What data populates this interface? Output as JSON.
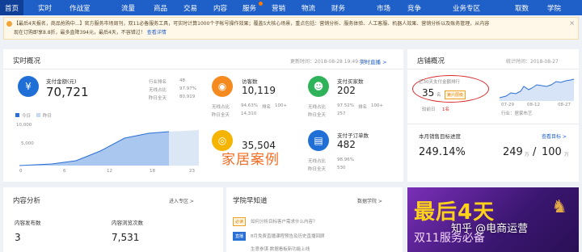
{
  "nav": {
    "items": [
      "首页",
      "实时",
      "作战室",
      "流量",
      "商品",
      "交易",
      "内容",
      "服务",
      "营销",
      "物流",
      "财务",
      "市场",
      "竞争",
      "业务专区",
      "取数",
      "学院"
    ],
    "active_index": 0
  },
  "notice": {
    "line1": "【最后4天报名，商品抢购中...】官方服务市场周刊，双11必备服务工具，可实时计算1000个子帐号操作效果；覆盖5大核心场景，重点包括：营销分析、服务体验、人工客服、机器人效果、营销分析以及账务管理，从内容",
    "line2": "现在订购即享8.8折，最多直降394元，最后4天，不容错过！",
    "link": "查看详情",
    "close": "×"
  },
  "realtime": {
    "title": "实时概况",
    "updated": "更新时间：2018-08-28 19:49:14",
    "view_link": "实时直播 >",
    "payment": {
      "label": "支付金额(元)",
      "value": "70,721",
      "stats": [
        {
          "name": "行业排名",
          "value": "48"
        },
        {
          "name": "无线占比",
          "value": "97.97%"
        },
        {
          "name": "昨日全天",
          "value": "80,919"
        }
      ]
    },
    "legend": {
      "today": "今日",
      "yesterday": "昨日"
    },
    "chart_y": [
      "10,000",
      "5,000"
    ],
    "chart_x": [
      "0",
      "6",
      "12",
      "18",
      "23"
    ],
    "visitors": {
      "label": "访客数",
      "value": "10,119",
      "stats": [
        {
          "name": "无线占比",
          "value": "94.63%"
        },
        {
          "name": "排名",
          "value": "100+"
        },
        {
          "name": "昨日全天",
          "value": "14,310"
        }
      ]
    },
    "buyers": {
      "label": "支付买家数",
      "value": "202",
      "stats": [
        {
          "name": "无线占比",
          "value": "97.52%"
        },
        {
          "name": "排名",
          "value": "100+"
        },
        {
          "name": "昨日全天",
          "value": "257"
        }
      ]
    },
    "third": {
      "value": "35,504"
    },
    "orders": {
      "label": "支付子订单数",
      "value": "482",
      "stats": [
        {
          "name": "无线占比",
          "value": "98.96%"
        },
        {
          "name": "昨日全天",
          "value": "530"
        }
      ]
    },
    "watermark": "家居案例"
  },
  "shop": {
    "title": "店铺概况",
    "stats_time": "统计时间：2018-08-27",
    "rank_label": "近30天支付金额排行",
    "rank_value": "35",
    "rank_unit": "名",
    "rank_tag": "第六层级",
    "prev_label": "较前日",
    "prev_value": "1名",
    "x_labels": [
      "07-29",
      "08-12",
      "08-27"
    ],
    "industry": "行业：居家布艺",
    "goal_title": "本月销售目标进度",
    "goal_link": "查看目标 >",
    "goal_pct": "249.14%",
    "goal_done": "249",
    "goal_unit": "万",
    "goal_sep": "/",
    "goal_total": "100",
    "goal_unit2": "万"
  },
  "content": {
    "title": "内容分析",
    "link": "进入专区 >",
    "publish_label": "内容发布数",
    "publish_value": "3",
    "browse_label": "内容浏览次数",
    "browse_value": "7,531"
  },
  "school": {
    "title": "学院早知道",
    "link": "数据学院 >",
    "items": [
      {
        "tag": "必读",
        "text": "如何分析目标客户需求什么内容？"
      },
      {
        "tag": "直播",
        "text": "8月免费直播课程预告及历史直播回顾"
      },
      {
        "tag": "",
        "text": "生意参谋·数据看板新功能上线"
      }
    ]
  },
  "promo": {
    "line1": "最后4天",
    "line2": "双11服务必备",
    "overlay": "知乎 @电商运营"
  }
}
